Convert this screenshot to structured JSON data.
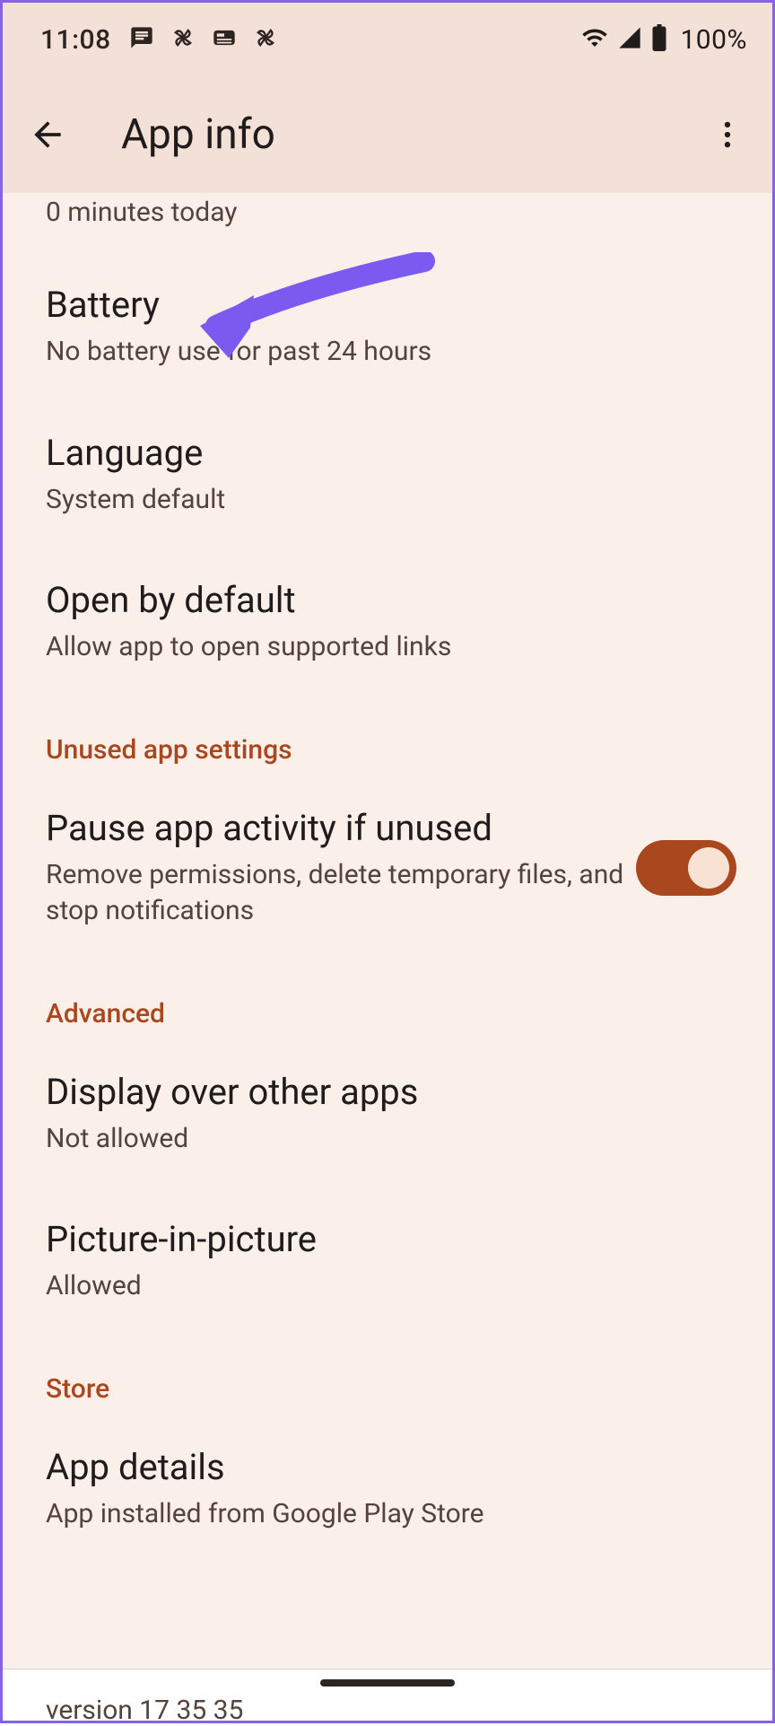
{
  "status": {
    "time": "11:08",
    "battery_pct": "100%"
  },
  "header": {
    "title": "App info"
  },
  "partial": {
    "screen_time_subtitle": "0 minutes today"
  },
  "settings": {
    "battery": {
      "title": "Battery",
      "subtitle": "No battery use for past 24 hours"
    },
    "language": {
      "title": "Language",
      "subtitle": "System default"
    },
    "open_by_default": {
      "title": "Open by default",
      "subtitle": "Allow app to open supported links"
    }
  },
  "sections": {
    "unused": {
      "header": "Unused app settings",
      "pause": {
        "title": "Pause app activity if unused",
        "subtitle": "Remove permissions, delete temporary files, and stop notifications",
        "toggle_on": true
      }
    },
    "advanced": {
      "header": "Advanced",
      "display_over": {
        "title": "Display over other apps",
        "subtitle": "Not allowed"
      },
      "pip": {
        "title": "Picture-in-picture",
        "subtitle": "Allowed"
      }
    },
    "store": {
      "header": "Store",
      "app_details": {
        "title": "App details",
        "subtitle": "App installed from Google Play Store"
      }
    }
  },
  "version": "version 17 35 35"
}
